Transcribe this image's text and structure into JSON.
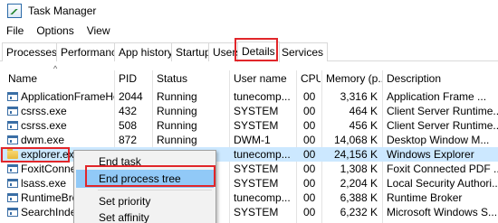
{
  "window": {
    "title": "Task Manager"
  },
  "menu": [
    "File",
    "Options",
    "View"
  ],
  "tabs": [
    "Processes",
    "Performance",
    "App history",
    "Startup",
    "Users",
    "Details",
    "Services"
  ],
  "active_tab": "Details",
  "table": {
    "columns": [
      "Name",
      "PID",
      "Status",
      "User name",
      "CPU",
      "Memory (p...",
      "Description"
    ],
    "rows": [
      {
        "name": "ApplicationFrameHo...",
        "pid": "2044",
        "status": "Running",
        "user": "tunecomp...",
        "cpu": "00",
        "memory": "3,316 K",
        "description": "Application Frame ..."
      },
      {
        "name": "csrss.exe",
        "pid": "432",
        "status": "Running",
        "user": "SYSTEM",
        "cpu": "00",
        "memory": "464 K",
        "description": "Client Server Runtime..."
      },
      {
        "name": "csrss.exe",
        "pid": "508",
        "status": "Running",
        "user": "SYSTEM",
        "cpu": "00",
        "memory": "456 K",
        "description": "Client Server Runtime..."
      },
      {
        "name": "dwm.exe",
        "pid": "872",
        "status": "Running",
        "user": "DWM-1",
        "cpu": "00",
        "memory": "14,068 K",
        "description": "Desktop Window M..."
      },
      {
        "name": "explorer.exe",
        "pid": "",
        "status": "",
        "user": "tunecomp...",
        "cpu": "00",
        "memory": "24,156 K",
        "description": "Windows Explorer"
      },
      {
        "name": "FoxitConnect",
        "pid": "",
        "status": "",
        "user": "SYSTEM",
        "cpu": "00",
        "memory": "1,308 K",
        "description": "Foxit Connected PDF ..."
      },
      {
        "name": "lsass.exe",
        "pid": "",
        "status": "",
        "user": "SYSTEM",
        "cpu": "00",
        "memory": "2,204 K",
        "description": "Local Security Authori..."
      },
      {
        "name": "RuntimeBroke",
        "pid": "",
        "status": "",
        "user": "tunecomp...",
        "cpu": "00",
        "memory": "6,388 K",
        "description": "Runtime Broker"
      },
      {
        "name": "SearchIndexe",
        "pid": "",
        "status": "",
        "user": "SYSTEM",
        "cpu": "00",
        "memory": "6,232 K",
        "description": "Microsoft Windows S..."
      }
    ]
  },
  "context_menu": {
    "items": [
      "End task",
      "End process tree",
      "Set priority",
      "Set affinity"
    ],
    "hovered": "End process tree"
  },
  "colors": {
    "highlight_border": "#e1262a",
    "selected_row": "#cce8ff",
    "menu_hover": "#91c9f7"
  },
  "icons": {
    "app": "task-manager-icon",
    "process": "window-app-icon",
    "explorer": "folder-icon"
  }
}
